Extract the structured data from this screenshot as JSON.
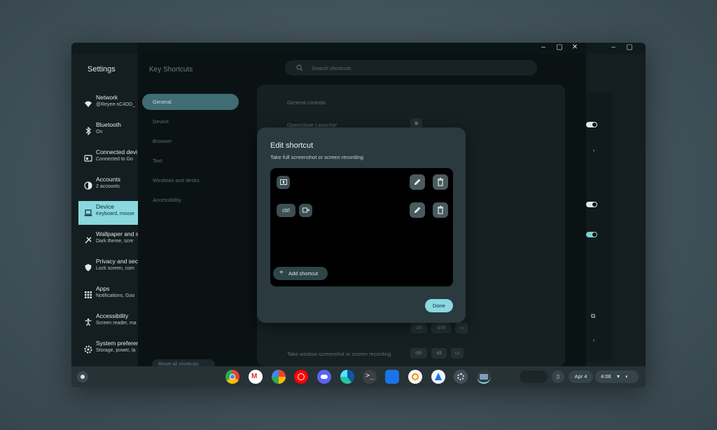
{
  "settings": {
    "title": "Settings",
    "nav": [
      {
        "label": "Network",
        "sub": "@Reyee-sC4DD_",
        "icon": "wifi-icon"
      },
      {
        "label": "Bluetooth",
        "sub": "On",
        "icon": "bluetooth-icon"
      },
      {
        "label": "Connected devi",
        "sub": "Connected to Go",
        "icon": "devices-icon"
      },
      {
        "label": "Accounts",
        "sub": "2 accounts",
        "icon": "account-icon"
      },
      {
        "label": "Device",
        "sub": "Keyboard, mouse",
        "icon": "laptop-icon"
      },
      {
        "label": "Wallpaper and s",
        "sub": "Dark theme, scre",
        "icon": "palette-icon"
      },
      {
        "label": "Privacy and sec",
        "sub": "Lock screen, com",
        "icon": "shield-icon"
      },
      {
        "label": "Apps",
        "sub": "Notifications, Goo",
        "icon": "apps-grid-icon"
      },
      {
        "label": "Accessibility",
        "sub": "Screen reader, ma",
        "icon": "accessibility-icon"
      },
      {
        "label": "System preferer",
        "sub": "Storage, power, la",
        "icon": "gear-icon"
      }
    ]
  },
  "key_shortcuts": {
    "title": "Key Shortcuts",
    "search_placeholder": "Search shortcuts",
    "nav": [
      "General",
      "Device",
      "Browser",
      "Text",
      "Windows and desks",
      "Accessibility"
    ],
    "reset_label": "Reset all shortcuts",
    "section_title": "General controls",
    "row1_label": "Open/close Launcher",
    "row_bottom_label": "Take window screenshot or screen recording",
    "keys_row_a": [
      "ctrl",
      "shift"
    ],
    "keys_row_b": [
      "ctrl",
      "alt"
    ]
  },
  "modal": {
    "title": "Edit shortcut",
    "subtitle": "Take full screenshot or screen recording",
    "shortcut2_modifier": "ctrl",
    "add_label": "Add shortcut",
    "done_label": "Done"
  },
  "shelf": {
    "apps": [
      "chrome-icon",
      "gmail-icon",
      "photos-icon",
      "youtube-music-icon",
      "discord-icon",
      "edge-icon",
      "terminal-icon",
      "files-icon",
      "audible-icon",
      "app-blue-icon",
      "settings-icon",
      "gallery-icon"
    ],
    "date": "Apr 4",
    "time": "4:08"
  },
  "colors": {
    "accent": "#8ad8e0",
    "modal_bg": "#2a3a3e",
    "shelf_bg": "#263235"
  }
}
